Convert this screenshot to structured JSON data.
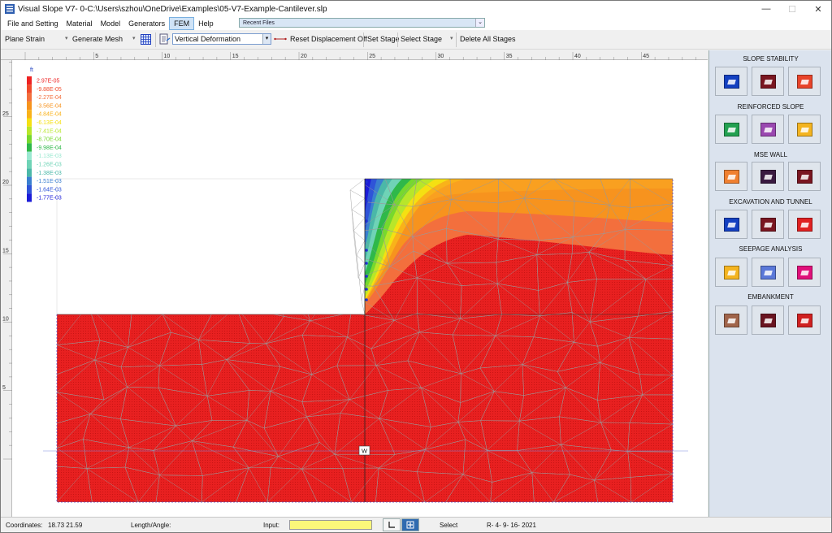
{
  "window": {
    "title": "Visual Slope V7- 0-C:\\Users\\szhou\\OneDrive\\Examples\\05-V7-Example-Cantilever.slp",
    "minimize": "—",
    "maximize": "☐",
    "close": "✕"
  },
  "menu": {
    "items": [
      "File and Setting",
      "Material",
      "Model",
      "Generators",
      "FEM",
      "Help"
    ],
    "active": "FEM",
    "recent_files": "Recent Files"
  },
  "toolbar": {
    "analysis_type": "Plane Strain",
    "generate_mesh": "Generate Mesh",
    "result_select": "Vertical Deformation",
    "reset_displacement": "Reset Displacement Off",
    "set_stage": "Set Stage",
    "select_stage": "Select Stage",
    "delete_all_stages": "Delete All Stages"
  },
  "ruler": {
    "top_labels": [
      "5",
      "10",
      "15",
      "20",
      "25",
      "30",
      "35",
      "40",
      "45"
    ],
    "left_labels": [
      "30",
      "25",
      "20",
      "15",
      "10",
      "5"
    ]
  },
  "legend": {
    "unit": "ft",
    "values": [
      "2.97E-05",
      "-9.88E-05",
      "-2.27E-04",
      "-3.56E-04",
      "-4.84E-04",
      "-6.13E-04",
      "-7.41E-04",
      "-8.70E-04",
      "-9.98E-04",
      "-1.13E-03",
      "-1.26E-03",
      "-1.38E-03",
      "-1.51E-03",
      "-1.64E-03",
      "-1.77E-03"
    ],
    "colors": [
      "#ee2222",
      "#f04a2a",
      "#f36f3d",
      "#f7931e",
      "#f9b21a",
      "#f5e012",
      "#b8e62a",
      "#77d82e",
      "#2fb84a",
      "#9ae8d0",
      "#6fd3b6",
      "#4bb8a8",
      "#3a7fd0",
      "#2f54d8",
      "#1c1cd8"
    ]
  },
  "water_label": "W",
  "right_panel": {
    "sections": [
      {
        "title": "SLOPE STABILITY",
        "buttons": [
          {
            "icon": "slope-stability-icon",
            "color": "#1440c0"
          },
          {
            "icon": "slope-stability-3d-icon",
            "color": "#7a1620"
          },
          {
            "icon": "slope-seismic-icon",
            "color": "#e8442a"
          }
        ]
      },
      {
        "title": "REINFORCED SLOPE",
        "buttons": [
          {
            "icon": "reinforced-slope-icon",
            "color": "#22a050"
          },
          {
            "icon": "reinforced-layer-icon",
            "color": "#9a48b0"
          },
          {
            "icon": "reinforced-wall-icon",
            "color": "#f4b420"
          }
        ]
      },
      {
        "title": "MSE WALL",
        "buttons": [
          {
            "icon": "mse-wall-icon",
            "color": "#f08030"
          },
          {
            "icon": "mse-block-icon",
            "color": "#3a1a40"
          },
          {
            "icon": "mse-crane-icon",
            "color": "#7a1620"
          }
        ]
      },
      {
        "title": "EXCAVATION AND TUNNEL",
        "buttons": [
          {
            "icon": "excavation-icon",
            "color": "#1440c0"
          },
          {
            "icon": "excavation-wall-icon",
            "color": "#7a1620"
          },
          {
            "icon": "tunnel-icon",
            "color": "#e02020"
          }
        ]
      },
      {
        "title": "SEEPAGE ANALYSIS",
        "buttons": [
          {
            "icon": "seepage-dam-icon",
            "color": "#f4b420"
          },
          {
            "icon": "seepage-cloud-icon",
            "color": "#5a78d8"
          },
          {
            "icon": "seepage-wall-icon",
            "color": "#e0107a"
          }
        ]
      },
      {
        "title": "EMBANKMENT",
        "buttons": [
          {
            "icon": "embankment-icon",
            "color": "#a0644a"
          },
          {
            "icon": "embankment-fill-icon",
            "color": "#6a1420"
          },
          {
            "icon": "embankment-pile-icon",
            "color": "#d02020"
          }
        ]
      }
    ]
  },
  "status": {
    "coordinates_label": "Coordinates:",
    "coordinates_value": "18.73  21.59",
    "length_angle_label": "Length/Angle:",
    "input_label": "Input:",
    "select_label": "Select",
    "version": "R- 4- 9- 16- 2021"
  }
}
